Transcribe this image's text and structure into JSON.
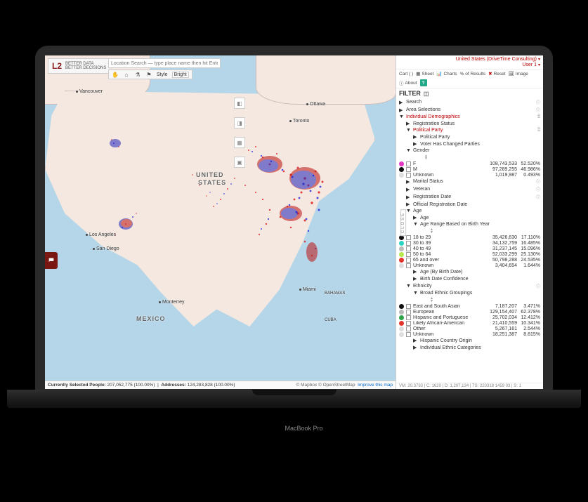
{
  "logo": {
    "mark": "L2",
    "line1": "BETTER DATA",
    "line2": "BETTER DECISIONS"
  },
  "search": {
    "placeholder": "Location Search — type place name then hit Enter"
  },
  "style": {
    "label": "Style",
    "value": "Bright"
  },
  "header": {
    "context": "United States (DriveTime Consulting)",
    "user": "User 1",
    "cart": "Cart ( )",
    "tabs": {
      "sheet": "Sheet",
      "charts": "Charts",
      "pct": "% of Results",
      "reset": "Reset",
      "image": "Image",
      "about": "About"
    }
  },
  "filter": {
    "title": "FILTER",
    "search": "Search",
    "area": "Area Selections",
    "indiv": "Individual Demographics",
    "regStatus": "Registration Status",
    "polParty": "Political Party",
    "polParty2": "Political Party",
    "changed": "Voter Has Changed Parties",
    "gender": "Gender",
    "genderRows": [
      {
        "color": "#e535c4",
        "label": "F",
        "count": "108,743,533",
        "pct": "52.520%"
      },
      {
        "color": "#111",
        "label": "M",
        "count": "97,289,255",
        "pct": "46.986%"
      },
      {
        "color": "#ddd",
        "label": "Unknown",
        "count": "1,019,987",
        "pct": "0.493%"
      }
    ],
    "marital": "Marital Status",
    "veteran": "Veteran",
    "regDate": "Registration Date",
    "offRegDate": "Official Registration Date",
    "age": "Age",
    "age2": "Age",
    "ageRange": "Age Range Based on Birth Year",
    "ageRows": [
      {
        "color": "#111",
        "label": "18 to 29",
        "count": "35,426,630",
        "pct": "17.110%"
      },
      {
        "color": "#2dd4c5",
        "label": "30 to 39",
        "count": "34,132,759",
        "pct": "16.485%"
      },
      {
        "color": "#bbb",
        "label": "40 to 49",
        "count": "31,237,145",
        "pct": "15.096%"
      },
      {
        "color": "#b7e84a",
        "label": "50 to 64",
        "count": "52,033,299",
        "pct": "25.130%"
      },
      {
        "color": "#e5352e",
        "label": "65 and over",
        "count": "50,798,288",
        "pct": "24.535%"
      },
      {
        "color": "#ddd",
        "label": "Unknown",
        "count": "3,404,654",
        "pct": "1.644%"
      }
    ],
    "ageBirth": "Age (By Birth Date)",
    "birthConf": "Birth Date Confidence",
    "ethnicity": "Ethnicity",
    "broadEth": "Broad Ethnic Groupings",
    "ethRows": [
      {
        "color": "#111",
        "label": "East and South Asian",
        "count": "7,187,207",
        "pct": "3.471%"
      },
      {
        "color": "#bbb",
        "label": "European",
        "count": "129,154,407",
        "pct": "62.378%"
      },
      {
        "color": "#2ea34a",
        "label": "Hispanic and Portuguese",
        "count": "25,702,034",
        "pct": "12.412%"
      },
      {
        "color": "#e5352e",
        "label": "Likely African-American",
        "count": "21,410,559",
        "pct": "10.341%"
      },
      {
        "color": "#ddd",
        "label": "Other",
        "count": "5,267,161",
        "pct": "2.544%"
      },
      {
        "color": "#ddd",
        "label": "Unknown",
        "count": "18,251,387",
        "pct": "8.815%"
      }
    ],
    "hispOrigin": "Hispanic Country Origin",
    "indivEth": "Individual Ethnic Categories"
  },
  "status": {
    "peopleLabel": "Currently Selected People:",
    "peopleValue": "207,052,775 (100.00%)",
    "addrLabel": "Addresses:",
    "addrValue": "124,283,828 (100.00%)",
    "attr": "© Mapbox © OpenStreetMap",
    "improve": "Improve this map"
  },
  "footer": "VM: 20.3793 | C: 1620 | D: 1,207,134 | TS: 220318 1459 03 | S: 1",
  "cities": {
    "vancouver": "Vancouver",
    "ottawa": "Ottawa",
    "toronto": "Toronto",
    "us": "UNITED",
    "us2": "STATES",
    "mexico": "MEXICO",
    "la": "Los Angeles",
    "sd": "San Diego",
    "monterrey": "Monterrey",
    "miami": "Miami",
    "bahamas": "BAHAMAS",
    "cuba": "CUBA"
  },
  "close": "CLOSE",
  "laptop": "MacBook Pro"
}
